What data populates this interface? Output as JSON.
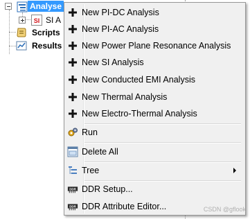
{
  "tree": {
    "nodes": [
      {
        "label": "Analyse"
      },
      {
        "label": "SI A"
      },
      {
        "label": "Scripts"
      },
      {
        "label": "Results"
      }
    ],
    "si_badge": "SI"
  },
  "menu": {
    "items": [
      {
        "label": "New PI-DC Analysis",
        "icon": "plus-icon"
      },
      {
        "label": "New PI-AC Analysis",
        "icon": "plus-icon"
      },
      {
        "label": "New Power Plane Resonance Analysis",
        "icon": "plus-icon"
      },
      {
        "label": "New SI Analysis",
        "icon": "plus-icon"
      },
      {
        "label": "New Conducted EMI Analysis",
        "icon": "plus-icon"
      },
      {
        "label": "New Thermal Analysis",
        "icon": "plus-icon"
      },
      {
        "label": "New Electro-Thermal Analysis",
        "icon": "plus-icon"
      },
      {
        "label": "Run",
        "icon": "gears-icon"
      },
      {
        "label": "Delete All",
        "icon": "delete-all-icon"
      },
      {
        "label": "Tree",
        "icon": "tree-icon"
      },
      {
        "label": "DDR Setup...",
        "icon": "ddr-icon"
      },
      {
        "label": "DDR Attribute Editor...",
        "icon": "ddr-icon"
      }
    ],
    "ddr_badge": "DDR"
  },
  "watermark": "CSDN @gflook",
  "colors": {
    "selection": "#3399ff",
    "menu_bg": "#f0f0f0",
    "si_red": "#d4161c"
  }
}
